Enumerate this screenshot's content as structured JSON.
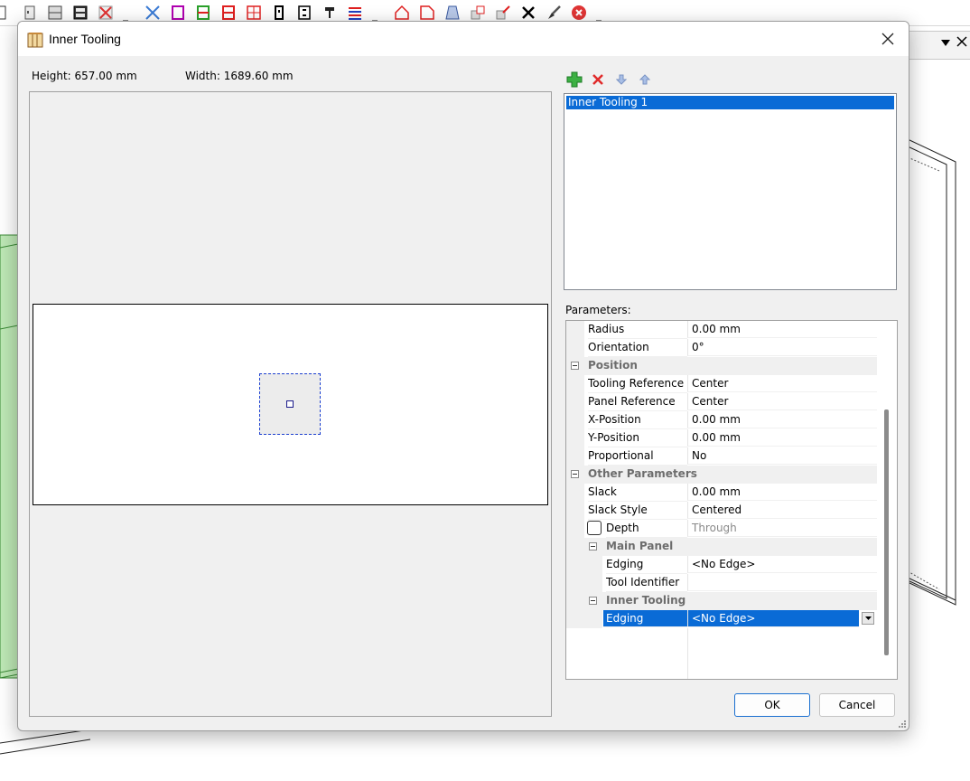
{
  "dialog": {
    "title": "Inner Tooling",
    "close_icon": "close-icon",
    "height_label": "Height: 657.00 mm",
    "width_label": "Width: 1689.60 mm"
  },
  "tooling_list": {
    "toolbar": [
      "add-icon",
      "delete-icon",
      "move-down-icon",
      "move-up-icon"
    ],
    "items": [
      "Inner Tooling 1"
    ],
    "selected": "Inner Tooling 1"
  },
  "parameters": {
    "label": "Parameters:",
    "rows": [
      {
        "name": "Radius",
        "value": "0.00 mm"
      },
      {
        "name": "Orientation",
        "value": "0°"
      },
      {
        "category": "Position"
      },
      {
        "name": "Tooling Reference",
        "value": "Center"
      },
      {
        "name": "Panel Reference",
        "value": "Center"
      },
      {
        "name": "X-Position",
        "value": "0.00 mm"
      },
      {
        "name": "Y-Position",
        "value": "0.00 mm"
      },
      {
        "name": "Proportional",
        "value": "No"
      },
      {
        "category": "Other Parameters"
      },
      {
        "name": "Slack",
        "value": "0.00 mm"
      },
      {
        "name": "Slack Style",
        "value": "Centered"
      },
      {
        "name": "Depth",
        "value": "Through",
        "checked": false,
        "disabled": true
      },
      {
        "subcategory": "Main Panel"
      },
      {
        "name": "Edging",
        "value": "<No Edge>"
      },
      {
        "name": "Tool Identifier",
        "value": ""
      },
      {
        "subcategory": "Inner Tooling"
      },
      {
        "name": "Edging",
        "value": "<No Edge>",
        "selected": true
      }
    ]
  },
  "buttons": {
    "ok": "OK",
    "cancel": "Cancel"
  },
  "colors": {
    "selection": "#0a6bd6",
    "dialog_bg": "#f0f0f0",
    "tool_outline": "#1c3fd0"
  }
}
